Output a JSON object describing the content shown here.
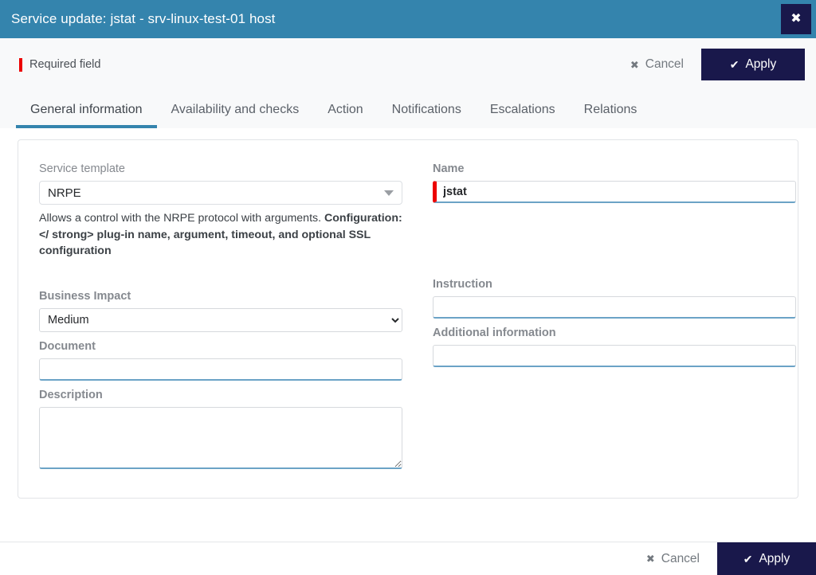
{
  "window": {
    "title": "Service update: jstat - srv-linux-test-01 host",
    "close_icon": "close-icon",
    "close_glyph": "✖",
    "titlebar_color": "#3484ad",
    "accent_color": "#19184b",
    "required_color": "#ec0000"
  },
  "toolbar": {
    "required_note": "Required field",
    "cancel_label": "Cancel",
    "apply_label": "Apply",
    "cancel_icon": "close-icon",
    "apply_icon": "check-icon",
    "cancel_glyph": "✖",
    "apply_glyph": "✔"
  },
  "tabs": [
    {
      "label": "General information",
      "active": true
    },
    {
      "label": "Availability and checks",
      "active": false
    },
    {
      "label": "Action",
      "active": false
    },
    {
      "label": "Notifications",
      "active": false
    },
    {
      "label": "Escalations",
      "active": false
    },
    {
      "label": "Relations",
      "active": false
    }
  ],
  "form": {
    "service_template": {
      "label": "Service template",
      "value": "NRPE",
      "options": [
        "NRPE"
      ],
      "help_line1": "Allows a control with the NRPE protocol with arguments.",
      "help_line2": "Configuration: </ strong> plug-in name, argument, timeout, and optional SSL configuration"
    },
    "name": {
      "label": "Name",
      "value": "jstat",
      "placeholder": "",
      "required": true
    },
    "business_impact": {
      "label": "Business Impact",
      "value": "Medium",
      "options": [
        "Medium"
      ]
    },
    "instruction": {
      "label": "Instruction",
      "value": "",
      "placeholder": ""
    },
    "document": {
      "label": "Document",
      "value": "",
      "placeholder": ""
    },
    "additional_information": {
      "label": "Additional information",
      "value": "",
      "placeholder": ""
    },
    "description": {
      "label": "Description",
      "value": "",
      "placeholder": ""
    }
  },
  "footer": {
    "cancel_label": "Cancel",
    "apply_label": "Apply",
    "cancel_glyph": "✖",
    "apply_glyph": "✔"
  }
}
